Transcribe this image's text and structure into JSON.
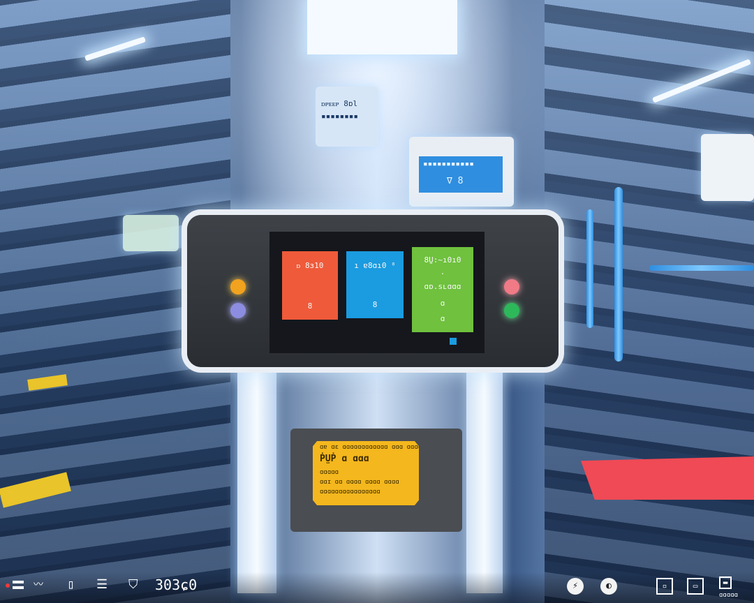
{
  "top_monitor": {
    "line1": "ᴅᴘᴇᴇᴘ 8ɒl",
    "line2": "▪▪▪▪▪▪▪▪"
  },
  "right_monitor": {
    "header": "▪▪▪▪▪▪▪▪▪▪▪",
    "glyphs": "∇  8"
  },
  "console": {
    "tiles": [
      {
        "title": "ᴅ 8ɜ10",
        "icon": "8"
      },
      {
        "title": "ı ɐ8ɑı0 ⁰",
        "icon": "8"
      },
      {
        "title": "8Ṵ:~ı0ı0",
        "sub": "·",
        "mid": "ɑɒ.sʟɑɑɑ",
        "icon": "ɑ",
        "foot": "ɑ"
      }
    ]
  },
  "lower_panel": {
    "line1": "ɑɐ ɑɛ ɑɑɑɑɑɑɑɑɑɑɑɑ ɑɑɑ ɑɑɑɑ",
    "line2": "ṖṲṖ ɑ ɑɑɑ",
    "line3": "ɑɑɑɑɑ",
    "line4": "ɑɑɪ ɑɑ ɑɑɑɑ ɑɑɑɑ ɑɑɑɑ",
    "line5": "ɑɑɑɑɑɑɑɑɑɑɑɑɑɑɑɑ"
  },
  "hud": {
    "score": "303ɕ0",
    "status": "ɑɑɑɑɑ",
    "colors": {
      "accent_red": "#ef3a3a",
      "hud_text": "#ffffff"
    }
  }
}
